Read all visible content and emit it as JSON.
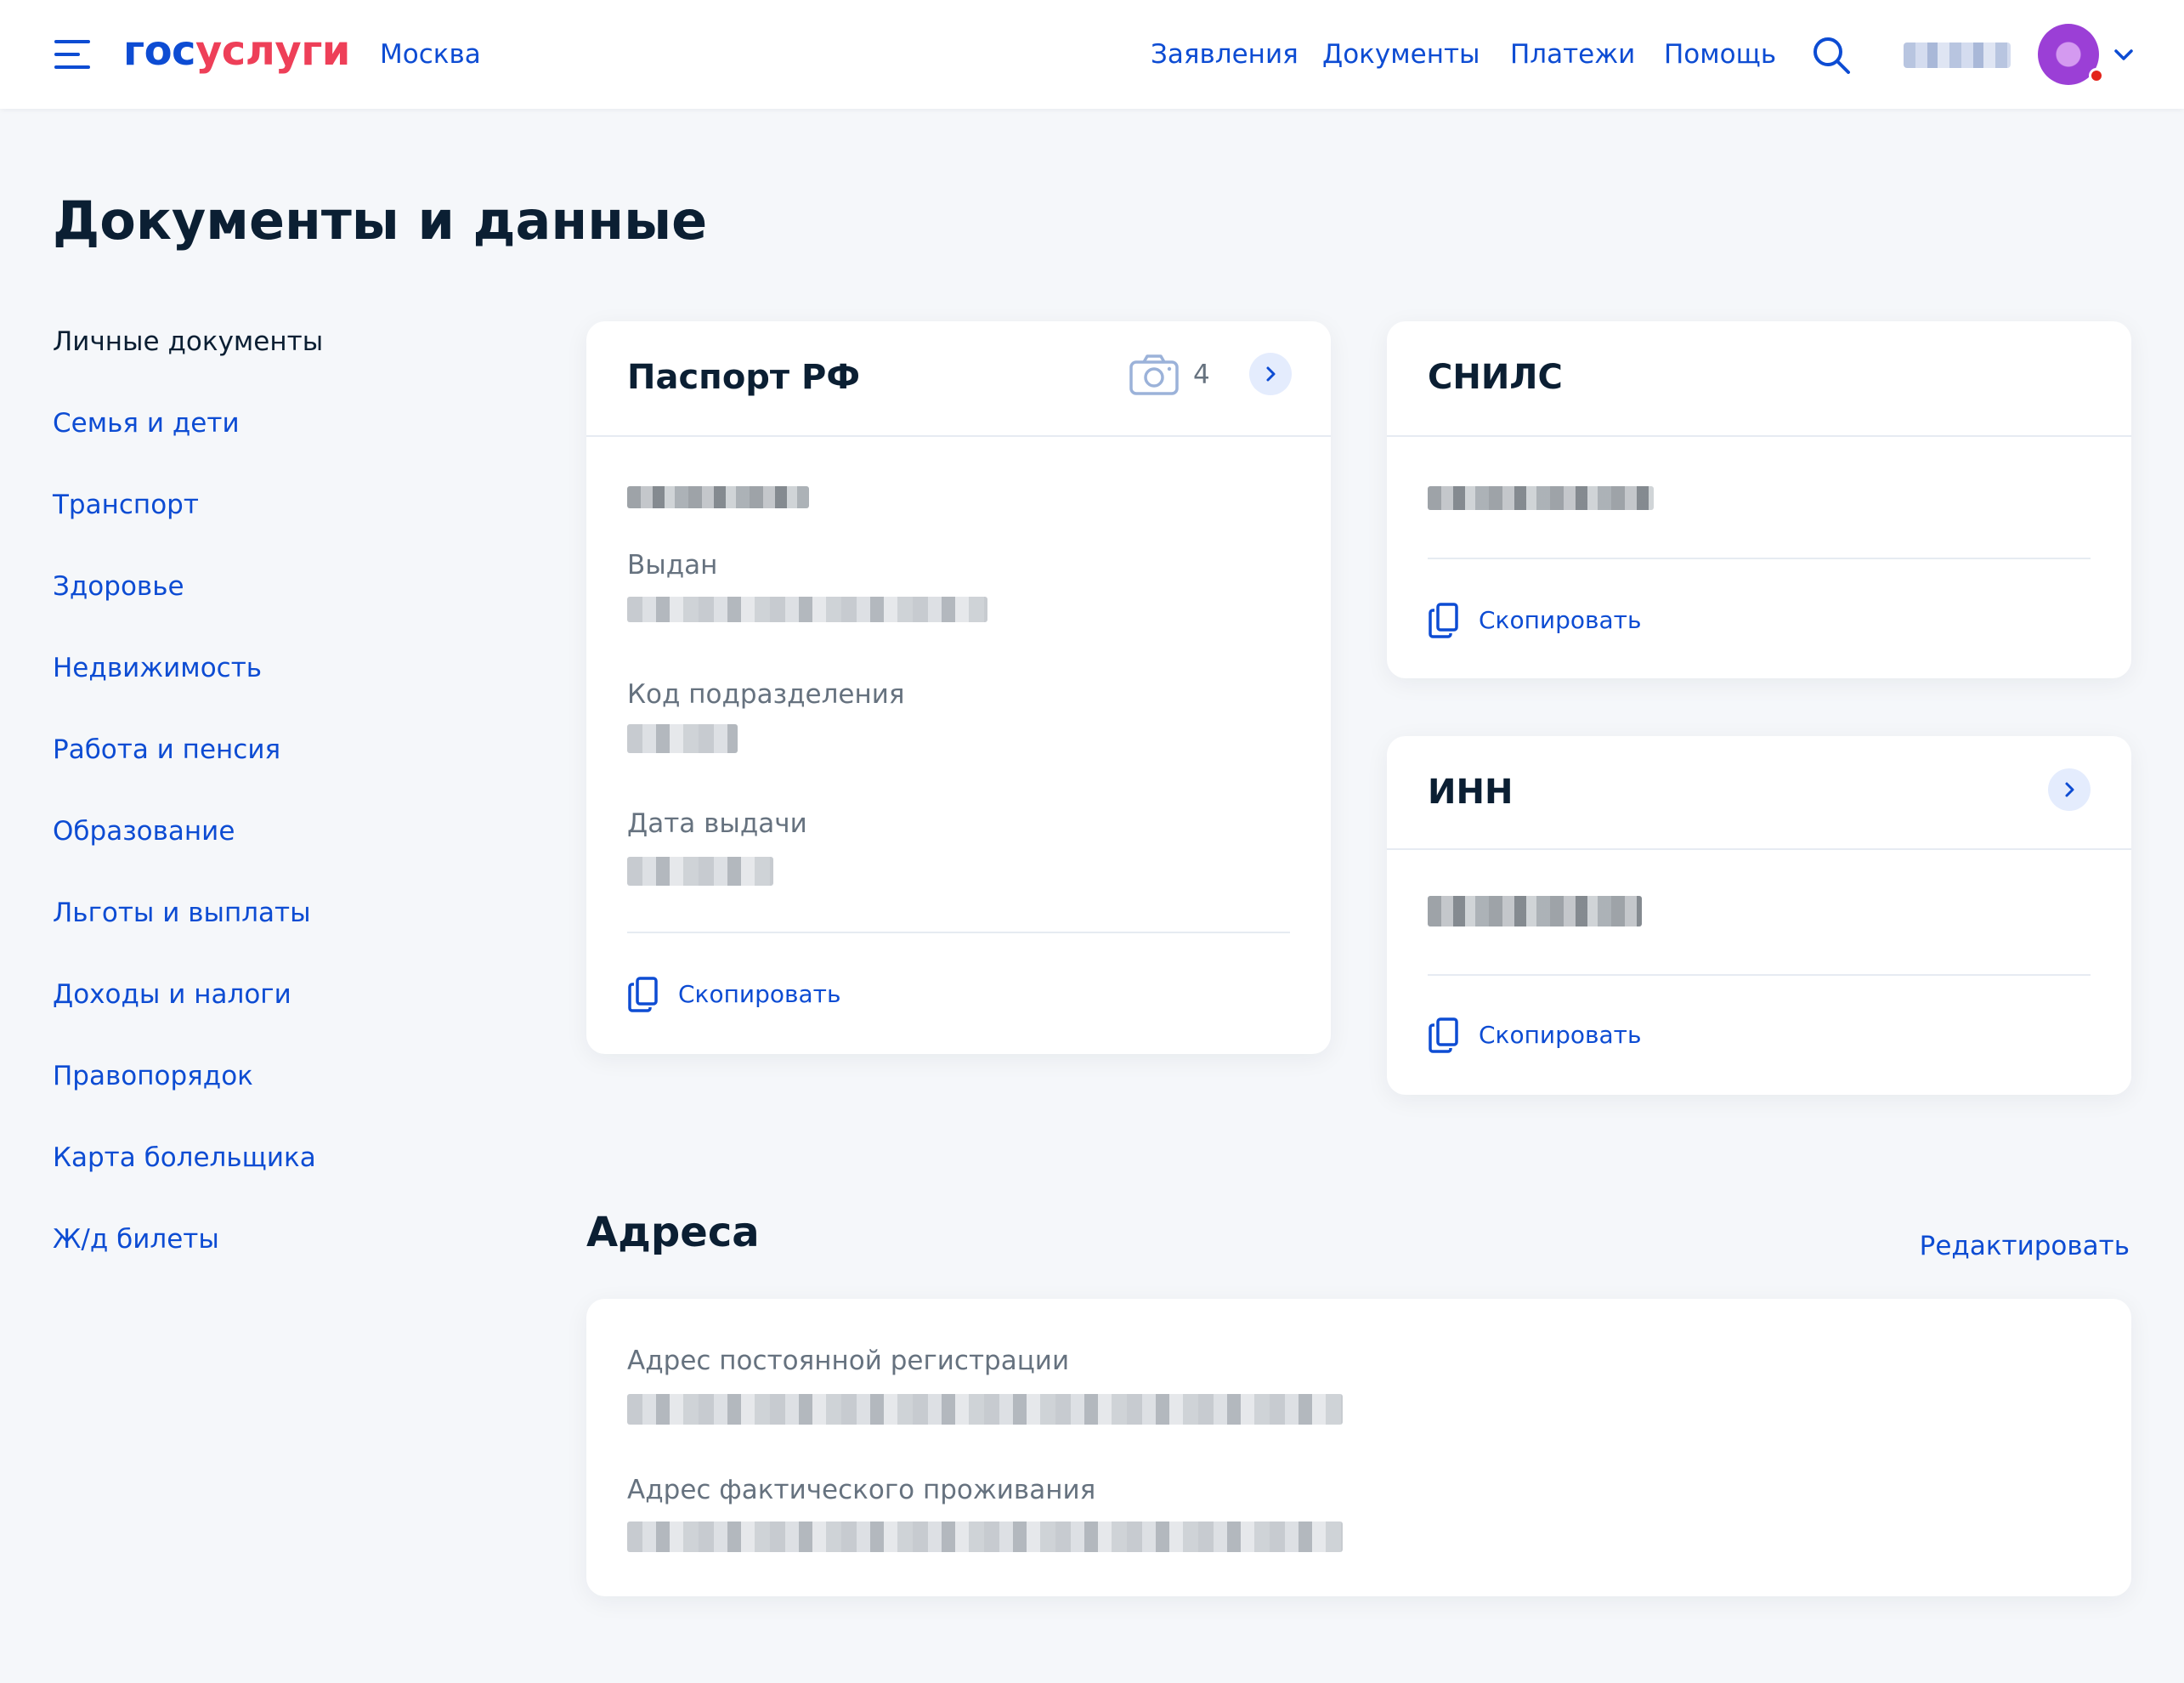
{
  "header": {
    "logo_part1": "гос",
    "logo_part2": "услуги",
    "city": "Москва",
    "nav": [
      "Заявления",
      "Документы",
      "Платежи",
      "Помощь"
    ]
  },
  "page": {
    "title": "Документы и данные"
  },
  "sidebar": {
    "items": [
      {
        "label": "Личные документы",
        "active": true
      },
      {
        "label": "Семья и дети"
      },
      {
        "label": "Транспорт"
      },
      {
        "label": "Здоровье"
      },
      {
        "label": "Недвижимость"
      },
      {
        "label": "Работа и пенсия"
      },
      {
        "label": "Образование"
      },
      {
        "label": "Льготы и выплаты"
      },
      {
        "label": "Доходы и налоги"
      },
      {
        "label": "Правопорядок"
      },
      {
        "label": "Карта болельщика"
      },
      {
        "label": "Ж/д билеты"
      }
    ]
  },
  "passport": {
    "title": "Паспорт РФ",
    "photo_count": "4",
    "issued_label": "Выдан",
    "division_code_label": "Код подразделения",
    "issue_date_label": "Дата выдачи",
    "copy_label": "Скопировать"
  },
  "snils": {
    "title": "СНИЛС",
    "copy_label": "Скопировать"
  },
  "inn": {
    "title": "ИНН",
    "copy_label": "Скопировать"
  },
  "addresses": {
    "title": "Адреса",
    "edit_label": "Редактировать",
    "permanent_label": "Адрес постоянной регистрации",
    "actual_label": "Адрес фактического проживания"
  },
  "colors": {
    "accent": "#0D4CD3",
    "logo_red": "#EE3F58",
    "background": "#F5F7FA",
    "text": "#0B1F33",
    "muted": "#66727F",
    "notification": "#E3241B"
  }
}
